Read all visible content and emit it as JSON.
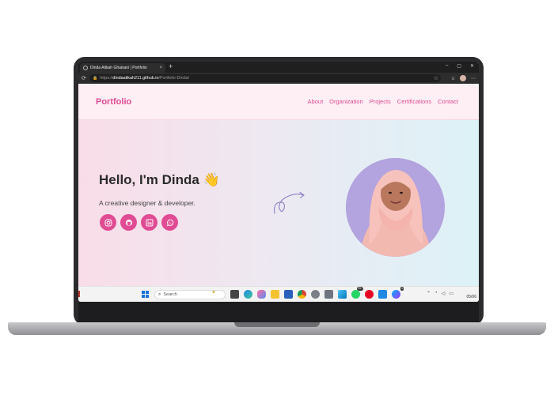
{
  "browser": {
    "tab_title": "Dinda Atikah Ghaisani | Portfolio",
    "tab_close": "×",
    "new_tab": "+",
    "url_prefix": "https://",
    "url_host": "dindaatikah211.github.io",
    "url_path": "/Portfolio-Dinda/",
    "window_controls": [
      "–",
      "▢",
      "✕"
    ]
  },
  "site": {
    "brand": "Portfolio",
    "nav": [
      "About",
      "Organization",
      "Projects",
      "Certifications",
      "Contact"
    ],
    "greeting": "Hello, I'm Dinda 👋",
    "tagline": "A creative designer & developer.",
    "socials": [
      {
        "name": "instagram",
        "icon": "instagram-icon"
      },
      {
        "name": "github",
        "icon": "github-icon"
      },
      {
        "name": "linkedin",
        "icon": "linkedin-icon"
      },
      {
        "name": "whatsapp",
        "icon": "whatsapp-icon"
      }
    ]
  },
  "colors": {
    "accent": "#e04b93",
    "photo_bg": "#b3a3de"
  },
  "taskbar": {
    "search_placeholder": "Search",
    "badges": [
      "99+",
      "4"
    ],
    "clock_date": "05/06"
  }
}
